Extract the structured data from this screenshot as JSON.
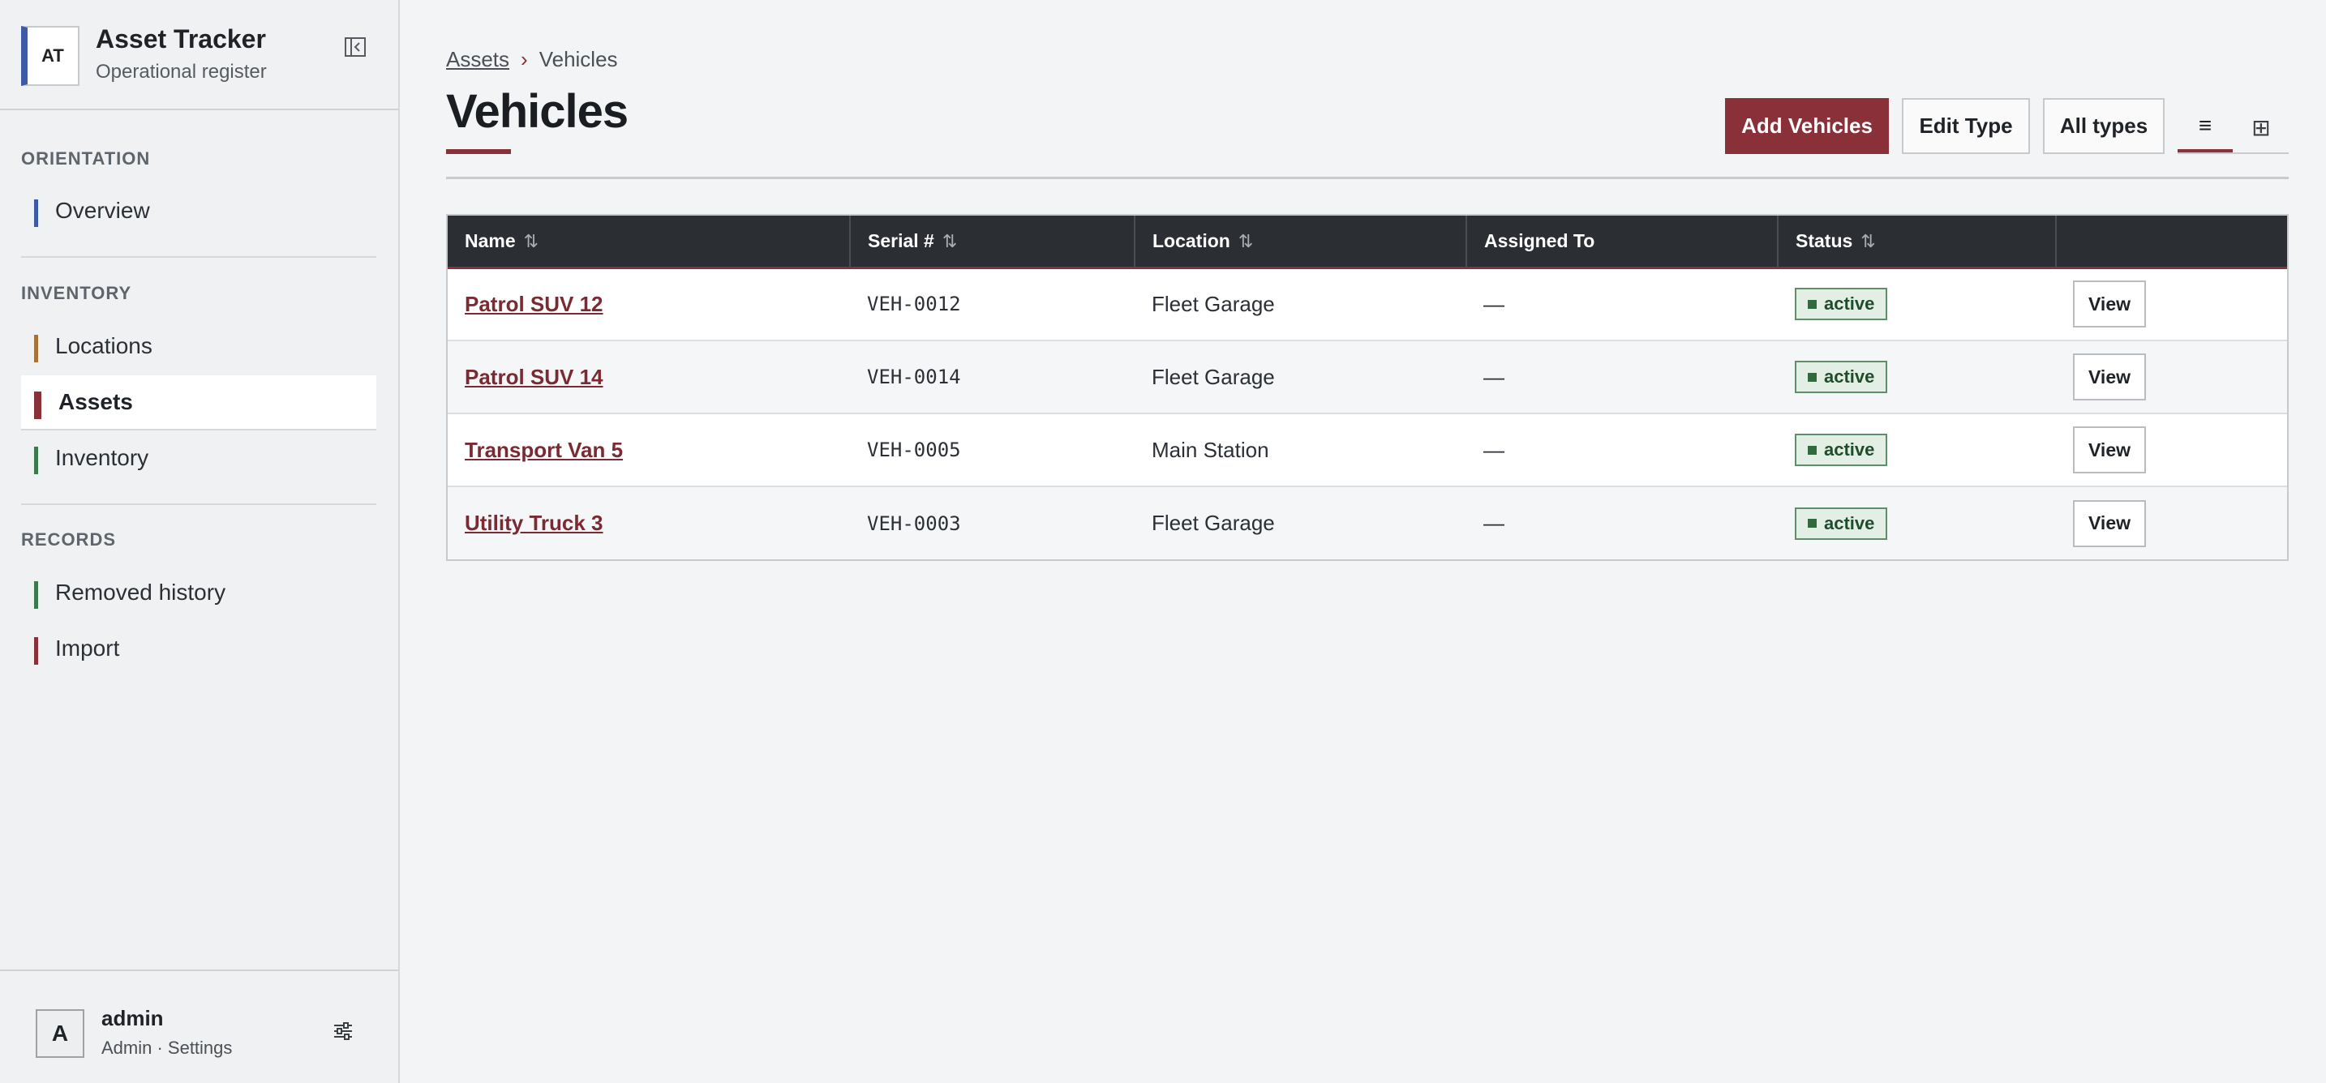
{
  "app": {
    "logo": "AT",
    "title": "Asset Tracker",
    "subtitle": "Operational register",
    "collapse_icon": "sidebar-collapse-icon"
  },
  "sidebar": {
    "sections": [
      {
        "label": "ORIENTATION",
        "items": [
          {
            "label": "Overview",
            "color": "#3b5aa8",
            "active": false
          }
        ]
      },
      {
        "label": "INVENTORY",
        "items": [
          {
            "label": "Locations",
            "color": "#a8733b",
            "active": false
          },
          {
            "label": "Assets",
            "color": "#8a3038",
            "active": true
          },
          {
            "label": "Inventory",
            "color": "#3b7a4e",
            "active": false
          }
        ]
      },
      {
        "label": "RECORDS",
        "items": [
          {
            "label": "Removed history",
            "color": "#3b7a4e",
            "active": false
          },
          {
            "label": "Import",
            "color": "#8a3038",
            "active": false
          }
        ]
      }
    ]
  },
  "user": {
    "initial": "A",
    "name": "admin",
    "role": "Admin · Settings",
    "settings_icon": "sliders-icon"
  },
  "breadcrumb": {
    "parent": "Assets",
    "separator": "›",
    "current": "Vehicles"
  },
  "page": {
    "title": "Vehicles"
  },
  "actions": {
    "add": "Add Vehicles",
    "edit_type": "Edit Type",
    "all_types": "All types",
    "list_view_icon": "≡",
    "grid_view_icon": "⊞"
  },
  "table": {
    "headers": [
      "Name",
      "Serial #",
      "Location",
      "Assigned To",
      "Status",
      ""
    ],
    "sort_icon": "⇅",
    "rows": [
      {
        "name": "Patrol SUV 12",
        "serial": "VEH-0012",
        "location": "Fleet Garage",
        "assigned": "—",
        "status": "active",
        "action": "View"
      },
      {
        "name": "Patrol SUV 14",
        "serial": "VEH-0014",
        "location": "Fleet Garage",
        "assigned": "—",
        "status": "active",
        "action": "View"
      },
      {
        "name": "Transport Van 5",
        "serial": "VEH-0005",
        "location": "Main Station",
        "assigned": "—",
        "status": "active",
        "action": "View"
      },
      {
        "name": "Utility Truck 3",
        "serial": "VEH-0003",
        "location": "Fleet Garage",
        "assigned": "—",
        "status": "active",
        "action": "View"
      }
    ]
  },
  "colors": {
    "accent": "#8a3038",
    "header_bg": "#2b2e33",
    "status_active": "#2f6b3c"
  }
}
